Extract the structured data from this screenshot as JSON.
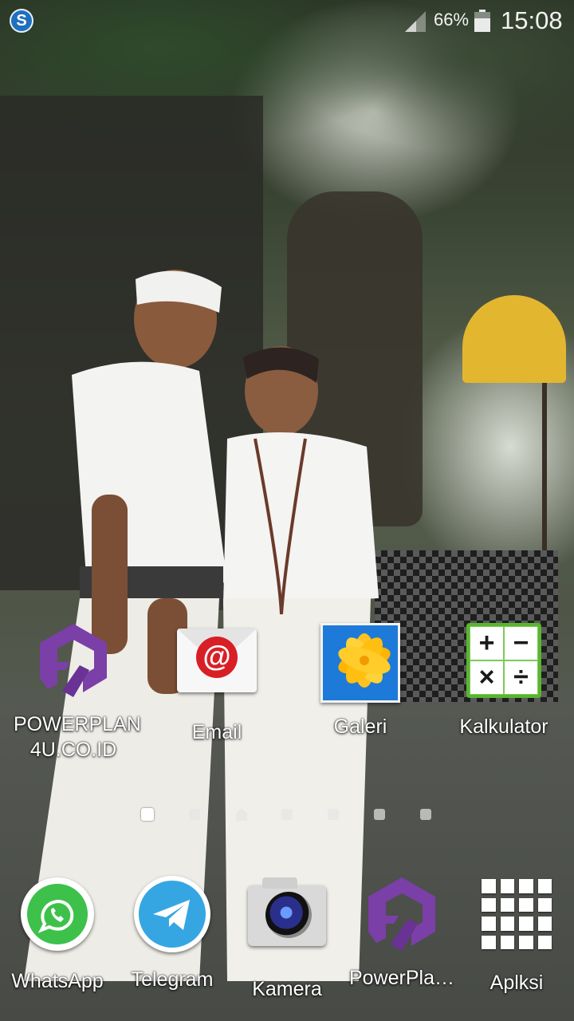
{
  "status_bar": {
    "app_icon": "s-circle-icon",
    "battery_percent": "66%",
    "time": "15:08"
  },
  "home_apps": [
    {
      "label": "POWERPLAN\n4U.CO.ID",
      "icon": "powerplan-logo-icon"
    },
    {
      "label": "Email",
      "icon": "email-icon"
    },
    {
      "label": "Galeri",
      "icon": "gallery-icon"
    },
    {
      "label": "Kalkulator",
      "icon": "calculator-icon"
    }
  ],
  "pager": {
    "page_count": 7,
    "active_index": 0,
    "home_index": 2
  },
  "dock_apps": [
    {
      "label": "WhatsApp",
      "icon": "whatsapp-icon"
    },
    {
      "label": "Telegram",
      "icon": "telegram-icon"
    },
    {
      "label": "Kamera",
      "icon": "camera-icon"
    },
    {
      "label": "PowerPla…",
      "icon": "powerplan-logo-icon"
    },
    {
      "label": "Aplksi",
      "icon": "app-drawer-icon"
    }
  ],
  "colors": {
    "powerplan_purple": "#7b3fa8",
    "whatsapp_green": "#3dc14a",
    "telegram_blue": "#36a6e3",
    "email_red": "#d81f26",
    "calculator_green": "#5ab52e"
  }
}
